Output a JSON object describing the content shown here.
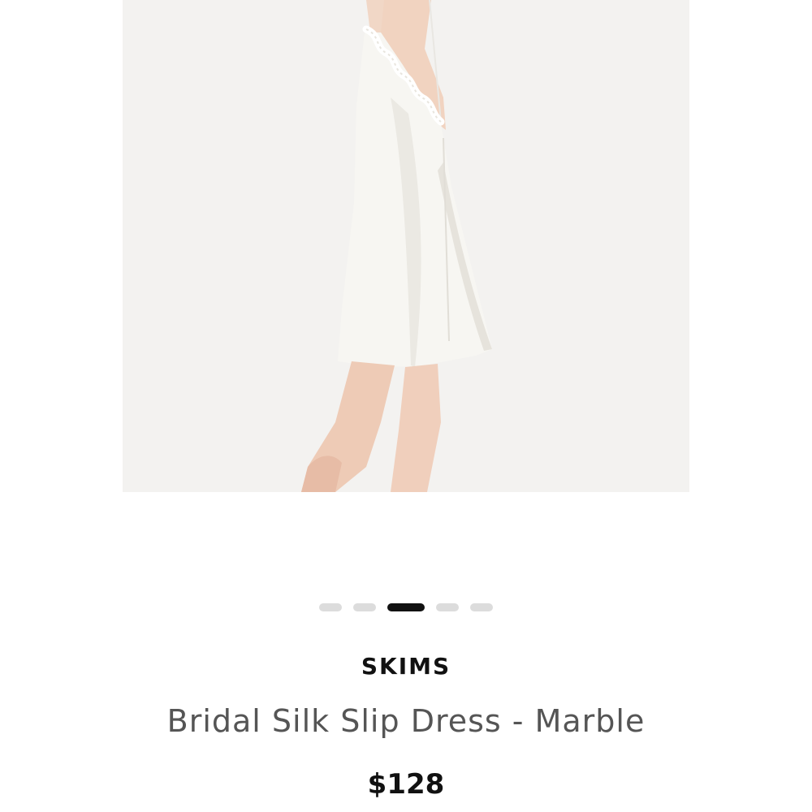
{
  "product": {
    "brand": "SKIMS",
    "name": "Bridal Silk Slip Dress - Marble",
    "price": "$128"
  },
  "carousel": {
    "total_slides": 5,
    "active_index": 2
  },
  "colors": {
    "background": "#ffffff",
    "image_background": "#f3f2f0",
    "dot_inactive": "#dcdcdc",
    "dot_active": "#111111",
    "brand_text": "#111111",
    "name_text": "#555555",
    "price_text": "#111111"
  }
}
